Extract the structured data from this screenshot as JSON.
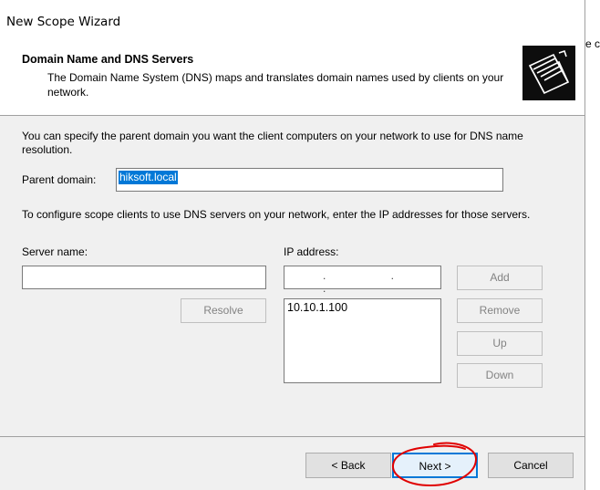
{
  "window": {
    "title": "New Scope Wizard",
    "outside_fragment": "e c"
  },
  "header": {
    "title": "Domain Name and DNS Servers",
    "description": "The Domain Name System (DNS) maps and translates domain names used by clients on your network.",
    "icon": "folders-icon"
  },
  "body": {
    "intro": "You can specify the parent domain you want the client computers on your network to use for DNS name resolution.",
    "parent_domain_label": "Parent domain:",
    "parent_domain_value": "hiksoft.local",
    "configure_text": "To configure scope clients to use DNS servers on your network, enter the IP addresses for those servers.",
    "server_name_label": "Server name:",
    "server_name_value": "",
    "ip_address_label": "IP address:",
    "ip_address_value": ". . .",
    "resolve_label": "Resolve",
    "add_label": "Add",
    "remove_label": "Remove",
    "up_label": "Up",
    "down_label": "Down",
    "ip_list": [
      "10.10.1.100"
    ]
  },
  "footer": {
    "back_label": "< Back",
    "next_label": "Next >",
    "cancel_label": "Cancel"
  },
  "colors": {
    "selection": "#0078d7",
    "annotation": "#e00000"
  }
}
